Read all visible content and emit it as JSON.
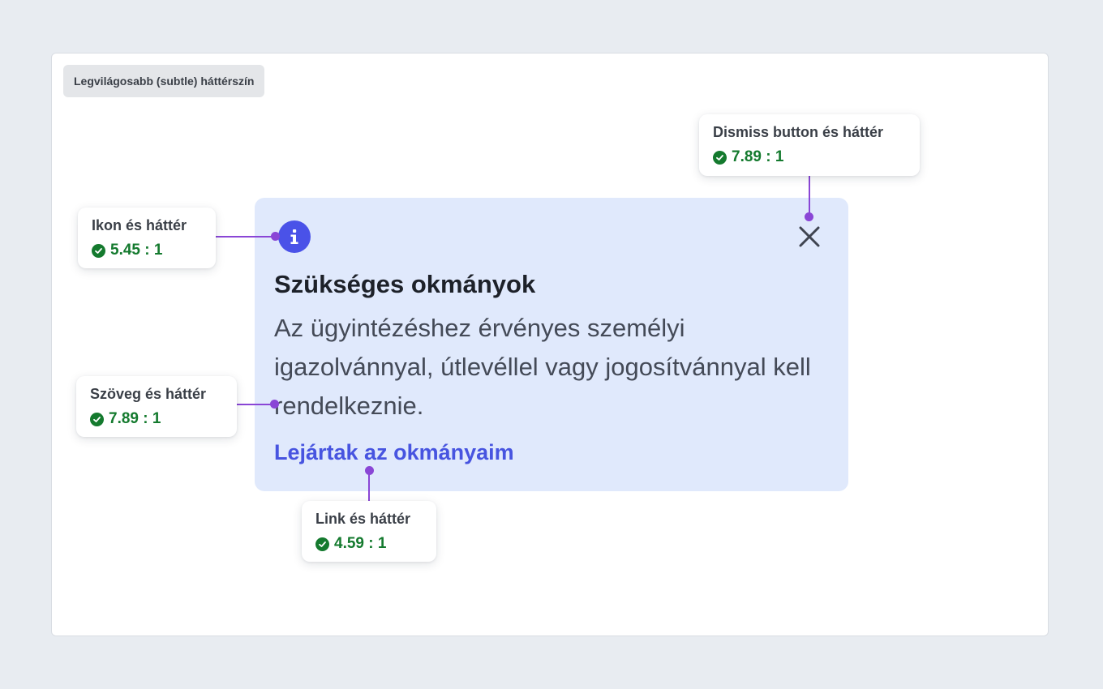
{
  "chip": {
    "label": "Legvilágosabb (subtle) háttérszín"
  },
  "alert": {
    "title": "Szükséges okmányok",
    "body": "Az ügyintézéshez érvényes személyi igazolvánnyal, útlevéllel vagy jogosítvánnyal kell rendelkeznie.",
    "link": "Lejártak az okmányaim",
    "icon": "info-icon",
    "dismiss_icon": "close-icon"
  },
  "callouts": {
    "dismiss": {
      "title": "Dismiss button és háttér",
      "ratio": "7.89 : 1"
    },
    "icon": {
      "title": "Ikon és háttér",
      "ratio": "5.45 : 1"
    },
    "text": {
      "title": "Szöveg és háttér",
      "ratio": "7.89 : 1"
    },
    "link": {
      "title": "Link és háttér",
      "ratio": "4.59 : 1"
    }
  },
  "colors": {
    "page_background": "#e8ecf1",
    "alert_background": "#e0e9fc",
    "info_icon": "#4a52e8",
    "link": "#4754e0",
    "pass": "#147a2e",
    "leader_line": "#8a46d6"
  }
}
